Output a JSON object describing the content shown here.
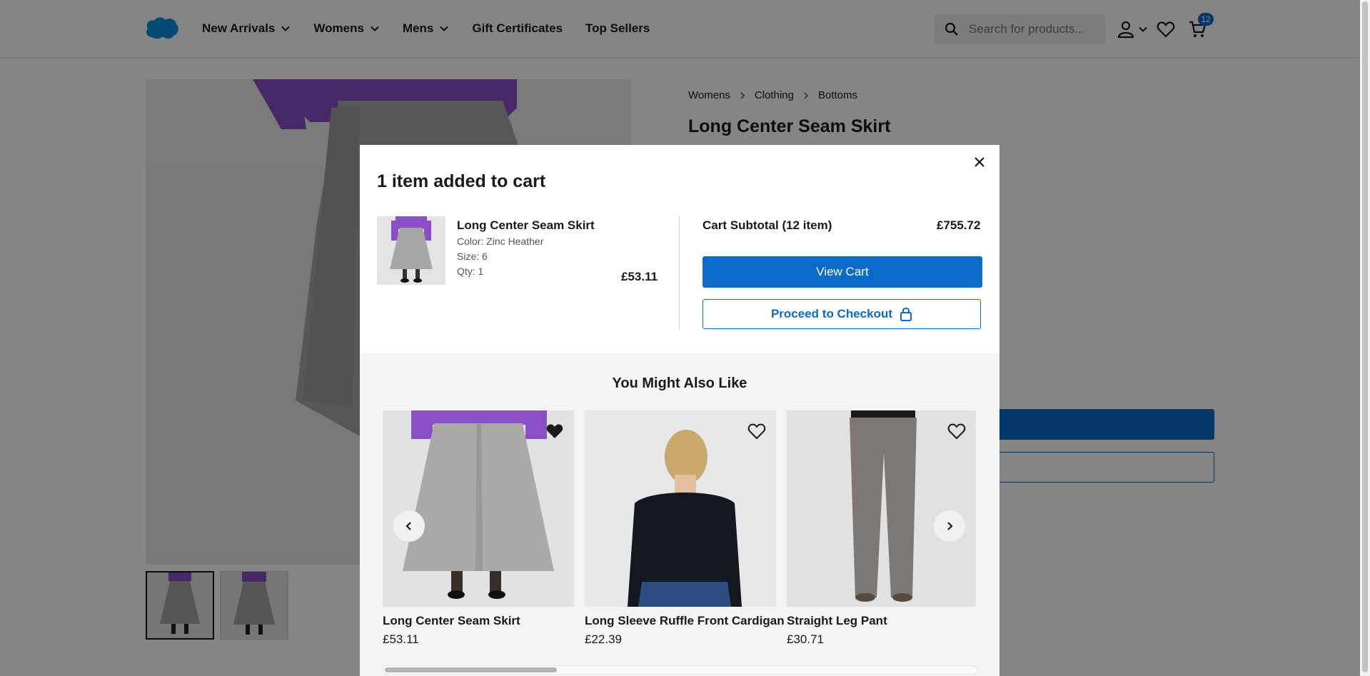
{
  "header": {
    "nav": [
      {
        "label": "New Arrivals",
        "dropdown": true
      },
      {
        "label": "Womens",
        "dropdown": true
      },
      {
        "label": "Mens",
        "dropdown": true
      },
      {
        "label": "Gift Certificates",
        "dropdown": false
      },
      {
        "label": "Top Sellers",
        "dropdown": false
      }
    ],
    "search_placeholder": "Search for products...",
    "cart_count": "12"
  },
  "product": {
    "breadcrumbs": [
      "Womens",
      "Clothing",
      "Bottoms"
    ],
    "title": "Long Center Seam Skirt"
  },
  "modal": {
    "title": "1 item added to cart",
    "item": {
      "name": "Long Center Seam Skirt",
      "color": "Color: Zinc Heather",
      "size": "Size: 6",
      "qty": "Qty: 1",
      "price": "£53.11"
    },
    "subtotal_label": "Cart Subtotal (12 item)",
    "subtotal_value": "£755.72",
    "view_cart": "View Cart",
    "checkout": "Proceed to Checkout",
    "recommendations_title": "You Might Also Like",
    "recommendations": [
      {
        "name": "Long Center Seam Skirt",
        "price": "£53.11",
        "wishlisted": true
      },
      {
        "name": "Long Sleeve Ruffle Front Cardigan",
        "price": "£22.39",
        "wishlisted": false
      },
      {
        "name": "Straight Leg Pant",
        "price": "£30.71",
        "wishlisted": false
      }
    ]
  },
  "colors": {
    "accent": "#0b6bcb",
    "purple_top": "#8a4fc7",
    "skirt_gray": "#a8a8a8"
  }
}
